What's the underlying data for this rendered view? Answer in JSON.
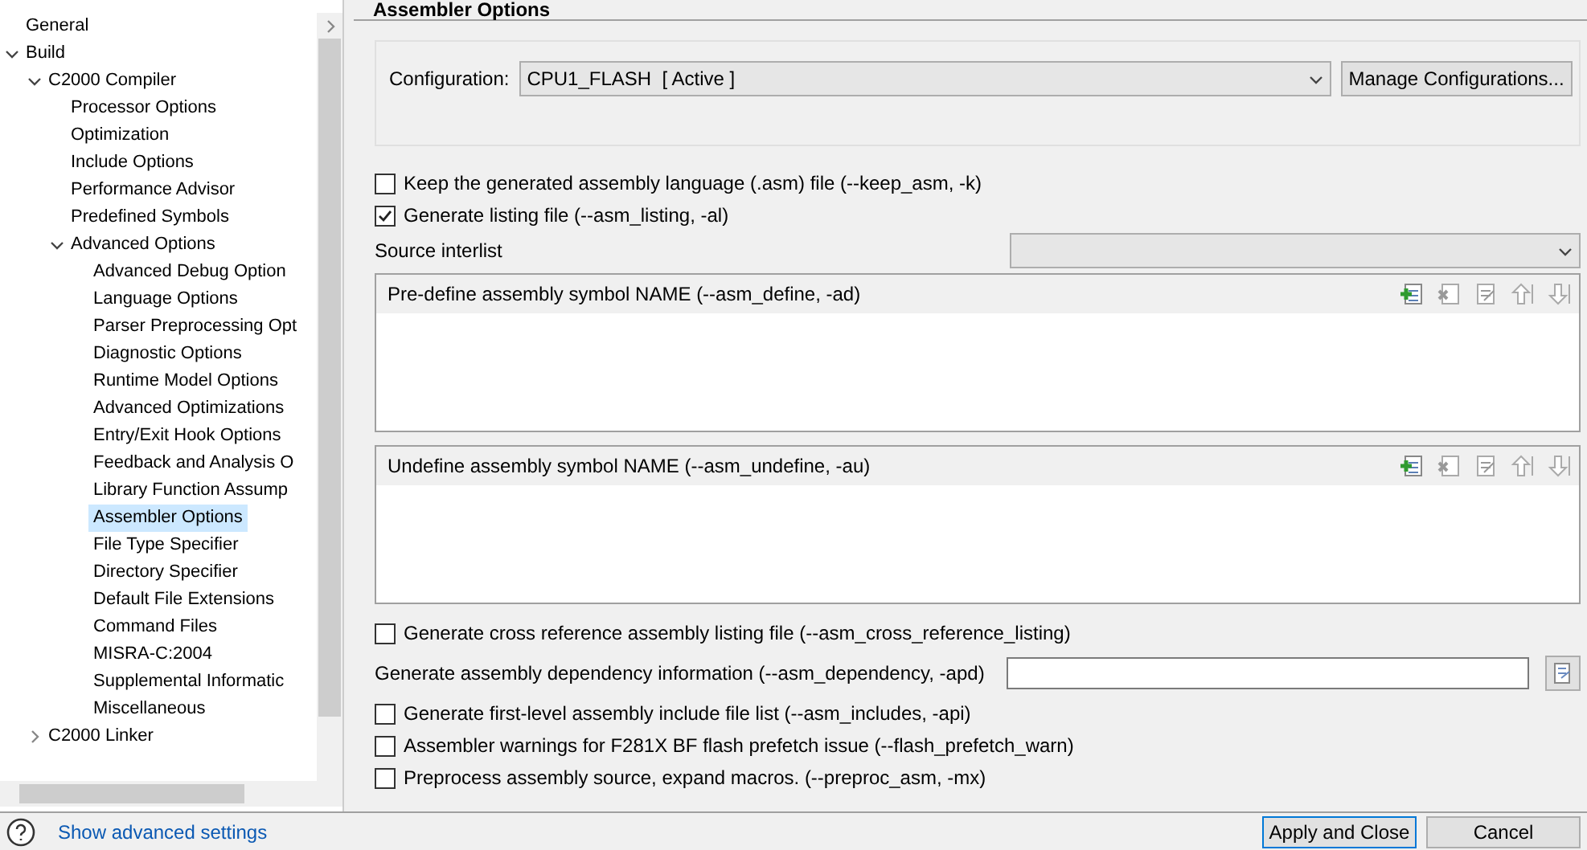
{
  "tree": [
    {
      "label": "General",
      "selected": false
    },
    {
      "label": "Build",
      "expanded": true,
      "selected": false,
      "children": [
        {
          "label": "C2000 Compiler",
          "expanded": true,
          "selected": false,
          "children": [
            {
              "label": "Processor Options",
              "selected": false
            },
            {
              "label": "Optimization",
              "selected": false
            },
            {
              "label": "Include Options",
              "selected": false
            },
            {
              "label": "Performance Advisor",
              "selected": false
            },
            {
              "label": "Predefined Symbols",
              "selected": false
            },
            {
              "label": "Advanced Options",
              "expanded": true,
              "selected": false,
              "children": [
                {
                  "label": "Advanced Debug Option",
                  "selected": false
                },
                {
                  "label": "Language Options",
                  "selected": false
                },
                {
                  "label": "Parser Preprocessing Opt",
                  "selected": false
                },
                {
                  "label": "Diagnostic Options",
                  "selected": false
                },
                {
                  "label": "Runtime Model Options",
                  "selected": false
                },
                {
                  "label": "Advanced Optimizations",
                  "selected": false
                },
                {
                  "label": "Entry/Exit Hook Options",
                  "selected": false
                },
                {
                  "label": "Feedback and Analysis O",
                  "selected": false
                },
                {
                  "label": "Library Function Assump",
                  "selected": false
                },
                {
                  "label": "Assembler Options",
                  "selected": true
                },
                {
                  "label": "File Type Specifier",
                  "selected": false
                },
                {
                  "label": "Directory Specifier",
                  "selected": false
                },
                {
                  "label": "Default File Extensions",
                  "selected": false
                },
                {
                  "label": "Command Files",
                  "selected": false
                },
                {
                  "label": "MISRA-C:2004",
                  "selected": false
                },
                {
                  "label": "Supplemental Informatic",
                  "selected": false
                },
                {
                  "label": "Miscellaneous",
                  "selected": false
                }
              ]
            }
          ]
        },
        {
          "label": "C2000 Linker",
          "expanded": false,
          "selected": false
        }
      ]
    }
  ],
  "page_title": "Assembler Options",
  "configuration": {
    "label": "Configuration:",
    "value": "CPU1_FLASH  [ Active ]",
    "button": "Manage Configurations..."
  },
  "options": [
    {
      "kind": "checkbox",
      "label": "Keep the generated assembly language (.asm) file (--keep_asm, -k)",
      "checked": false
    },
    {
      "kind": "checkbox",
      "label": "Generate listing file (--asm_listing, -al)",
      "checked": true
    },
    {
      "kind": "combo",
      "label": "Source interlist"
    },
    {
      "kind": "list",
      "label": "Pre-define assembly symbol NAME (--asm_define, -ad)"
    },
    {
      "kind": "list",
      "label": "Undefine assembly symbol NAME (--asm_undefine, -au)"
    },
    {
      "kind": "checkbox",
      "label": "Generate cross reference assembly listing file (--asm_cross_reference_listing)",
      "checked": false
    },
    {
      "kind": "text",
      "label": "Generate assembly dependency information (--asm_dependency, -apd)"
    },
    {
      "kind": "checkbox",
      "label": "Generate first-level assembly include file list (--asm_includes, -api)",
      "checked": false
    },
    {
      "kind": "checkbox",
      "label": "Assembler warnings for F281X BF flash prefetch issue (--flash_prefetch_warn)",
      "checked": false
    },
    {
      "kind": "checkbox",
      "label": "Preprocess assembly source, expand macros. (--preproc_asm, -mx)",
      "checked": false
    }
  ],
  "footer": {
    "link": "Show advanced settings",
    "buttons": [
      "Apply and Close",
      "Cancel"
    ]
  }
}
